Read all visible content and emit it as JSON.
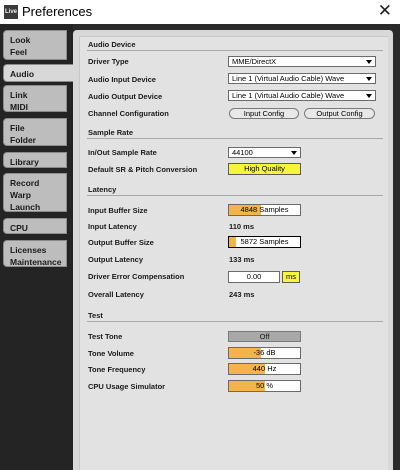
{
  "window": {
    "title": "Preferences",
    "icon_text": "Live",
    "close_icon": "close-icon"
  },
  "sidebar": {
    "tabs": [
      {
        "line1": "Look",
        "line2": "Feel"
      },
      {
        "line1": "Audio",
        "line2": ""
      },
      {
        "line1": "Link",
        "line2": "MIDI"
      },
      {
        "line1": "File",
        "line2": "Folder"
      },
      {
        "line1": "Library",
        "line2": ""
      },
      {
        "line1": "Record",
        "line2": "Warp",
        "line3": "Launch"
      },
      {
        "line1": "CPU",
        "line2": ""
      },
      {
        "line1": "Licenses",
        "line2": "Maintenance"
      }
    ]
  },
  "audio_device": {
    "title": "Audio Device",
    "driver_type_label": "Driver Type",
    "driver_type_value": "MME/DirectX",
    "input_device_label": "Audio Input Device",
    "input_device_value": "Line 1 (Virtual Audio Cable) Wave",
    "output_device_label": "Audio Output Device",
    "output_device_value": "Line 1 (Virtual Audio Cable) Wave",
    "channel_config_label": "Channel Configuration",
    "input_config_button": "Input Config",
    "output_config_button": "Output Config"
  },
  "sample_rate": {
    "title": "Sample Rate",
    "in_out_label": "In/Out Sample Rate",
    "in_out_value": "44100",
    "default_sr_label": "Default SR & Pitch Conversion",
    "default_sr_value": "High Quality"
  },
  "latency": {
    "title": "Latency",
    "input_buffer_label": "Input Buffer Size",
    "input_buffer_value": "4848 Samples",
    "input_latency_label": "Input Latency",
    "input_latency_value": "110 ms",
    "output_buffer_label": "Output Buffer Size",
    "output_buffer_value": "5872 Samples",
    "output_latency_label": "Output Latency",
    "output_latency_value": "133 ms",
    "driver_comp_label": "Driver Error Compensation",
    "driver_comp_value": "0.00",
    "driver_comp_unit": "ms",
    "overall_latency_label": "Overall Latency",
    "overall_latency_value": "243 ms"
  },
  "test": {
    "title": "Test",
    "test_tone_label": "Test Tone",
    "test_tone_value": "Off",
    "tone_volume_label": "Tone Volume",
    "tone_volume_value": "-36 dB",
    "tone_volume_level": 0.45,
    "tone_frequency_label": "Tone Frequency",
    "tone_frequency_value": "440 Hz",
    "tone_frequency_level": 0.5,
    "cpu_sim_label": "CPU Usage Simulator",
    "cpu_sim_value": "50 %",
    "cpu_sim_level": 0.5
  },
  "colors": {
    "accent_yellow": "#f5f53a",
    "accent_orange": "#f3b54a",
    "sidebar_bg": "#242424",
    "panel_bg": "#d8d8d8"
  }
}
